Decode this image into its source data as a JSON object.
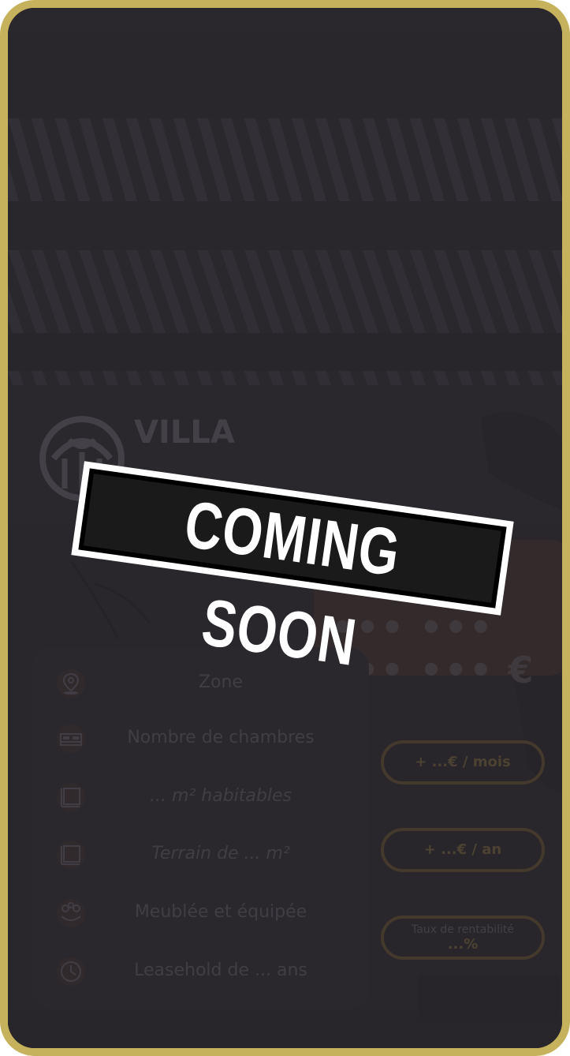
{
  "brand": {
    "name": "VILLA",
    "logo_icon": "villa-roof-logo-icon"
  },
  "stamp": {
    "text": "COMING SOON"
  },
  "price": {
    "label": "... ...",
    "value": "••• ••• ••• •••  €"
  },
  "features": [
    {
      "icon": "location-pin-icon",
      "label": "Zone",
      "italic": false
    },
    {
      "icon": "bed-icon",
      "label": "Nombre de chambres",
      "italic": false
    },
    {
      "icon": "floor-area-icon",
      "label": "... m² habitables",
      "italic": true
    },
    {
      "icon": "land-plot-icon",
      "label": "Terrain de ... m²",
      "italic": true
    },
    {
      "icon": "furnished-icon",
      "label": "Meublée et équipée",
      "italic": false
    },
    {
      "icon": "clock-icon",
      "label": "Leasehold de ... ans",
      "italic": false
    }
  ],
  "returns": {
    "monthly": "+ ...€ / mois",
    "yearly": "+ ...€ / an",
    "rate_label": "Taux de rentabilité",
    "rate_value": "...%"
  },
  "colors": {
    "frame": "#c6b25c",
    "background": "#2f2b31",
    "accent": "#5a4a2e"
  }
}
